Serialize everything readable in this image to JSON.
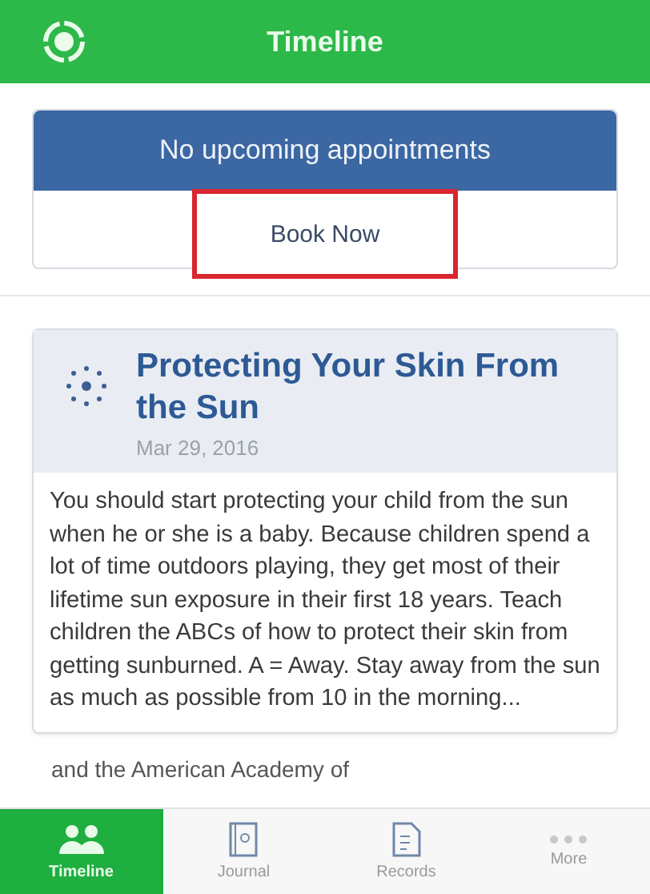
{
  "header": {
    "title": "Timeline"
  },
  "appointments": {
    "message": "No upcoming appointments",
    "action": "Book Now",
    "action_highlighted": true
  },
  "article": {
    "title": "Protecting Your Skin From the Sun",
    "date": "Mar 29, 2016",
    "body": "You should start protecting your child from the sun when he or she is a baby. Because children spend a lot of time outdoors playing, they get most of their lifetime sun exposure in their first 18 years.  Teach children the ABCs of how to protect their skin from getting sunburned. A = Away. Stay away from the sun as much as possible from 10 in the morning..."
  },
  "next_text": "and the American Academy of",
  "tabs": [
    {
      "label": "Timeline",
      "kind": "people",
      "selected": true
    },
    {
      "label": "Journal",
      "kind": "journal",
      "selected": false
    },
    {
      "label": "Records",
      "kind": "records",
      "selected": false
    },
    {
      "label": "More",
      "kind": "more",
      "selected": false
    }
  ]
}
